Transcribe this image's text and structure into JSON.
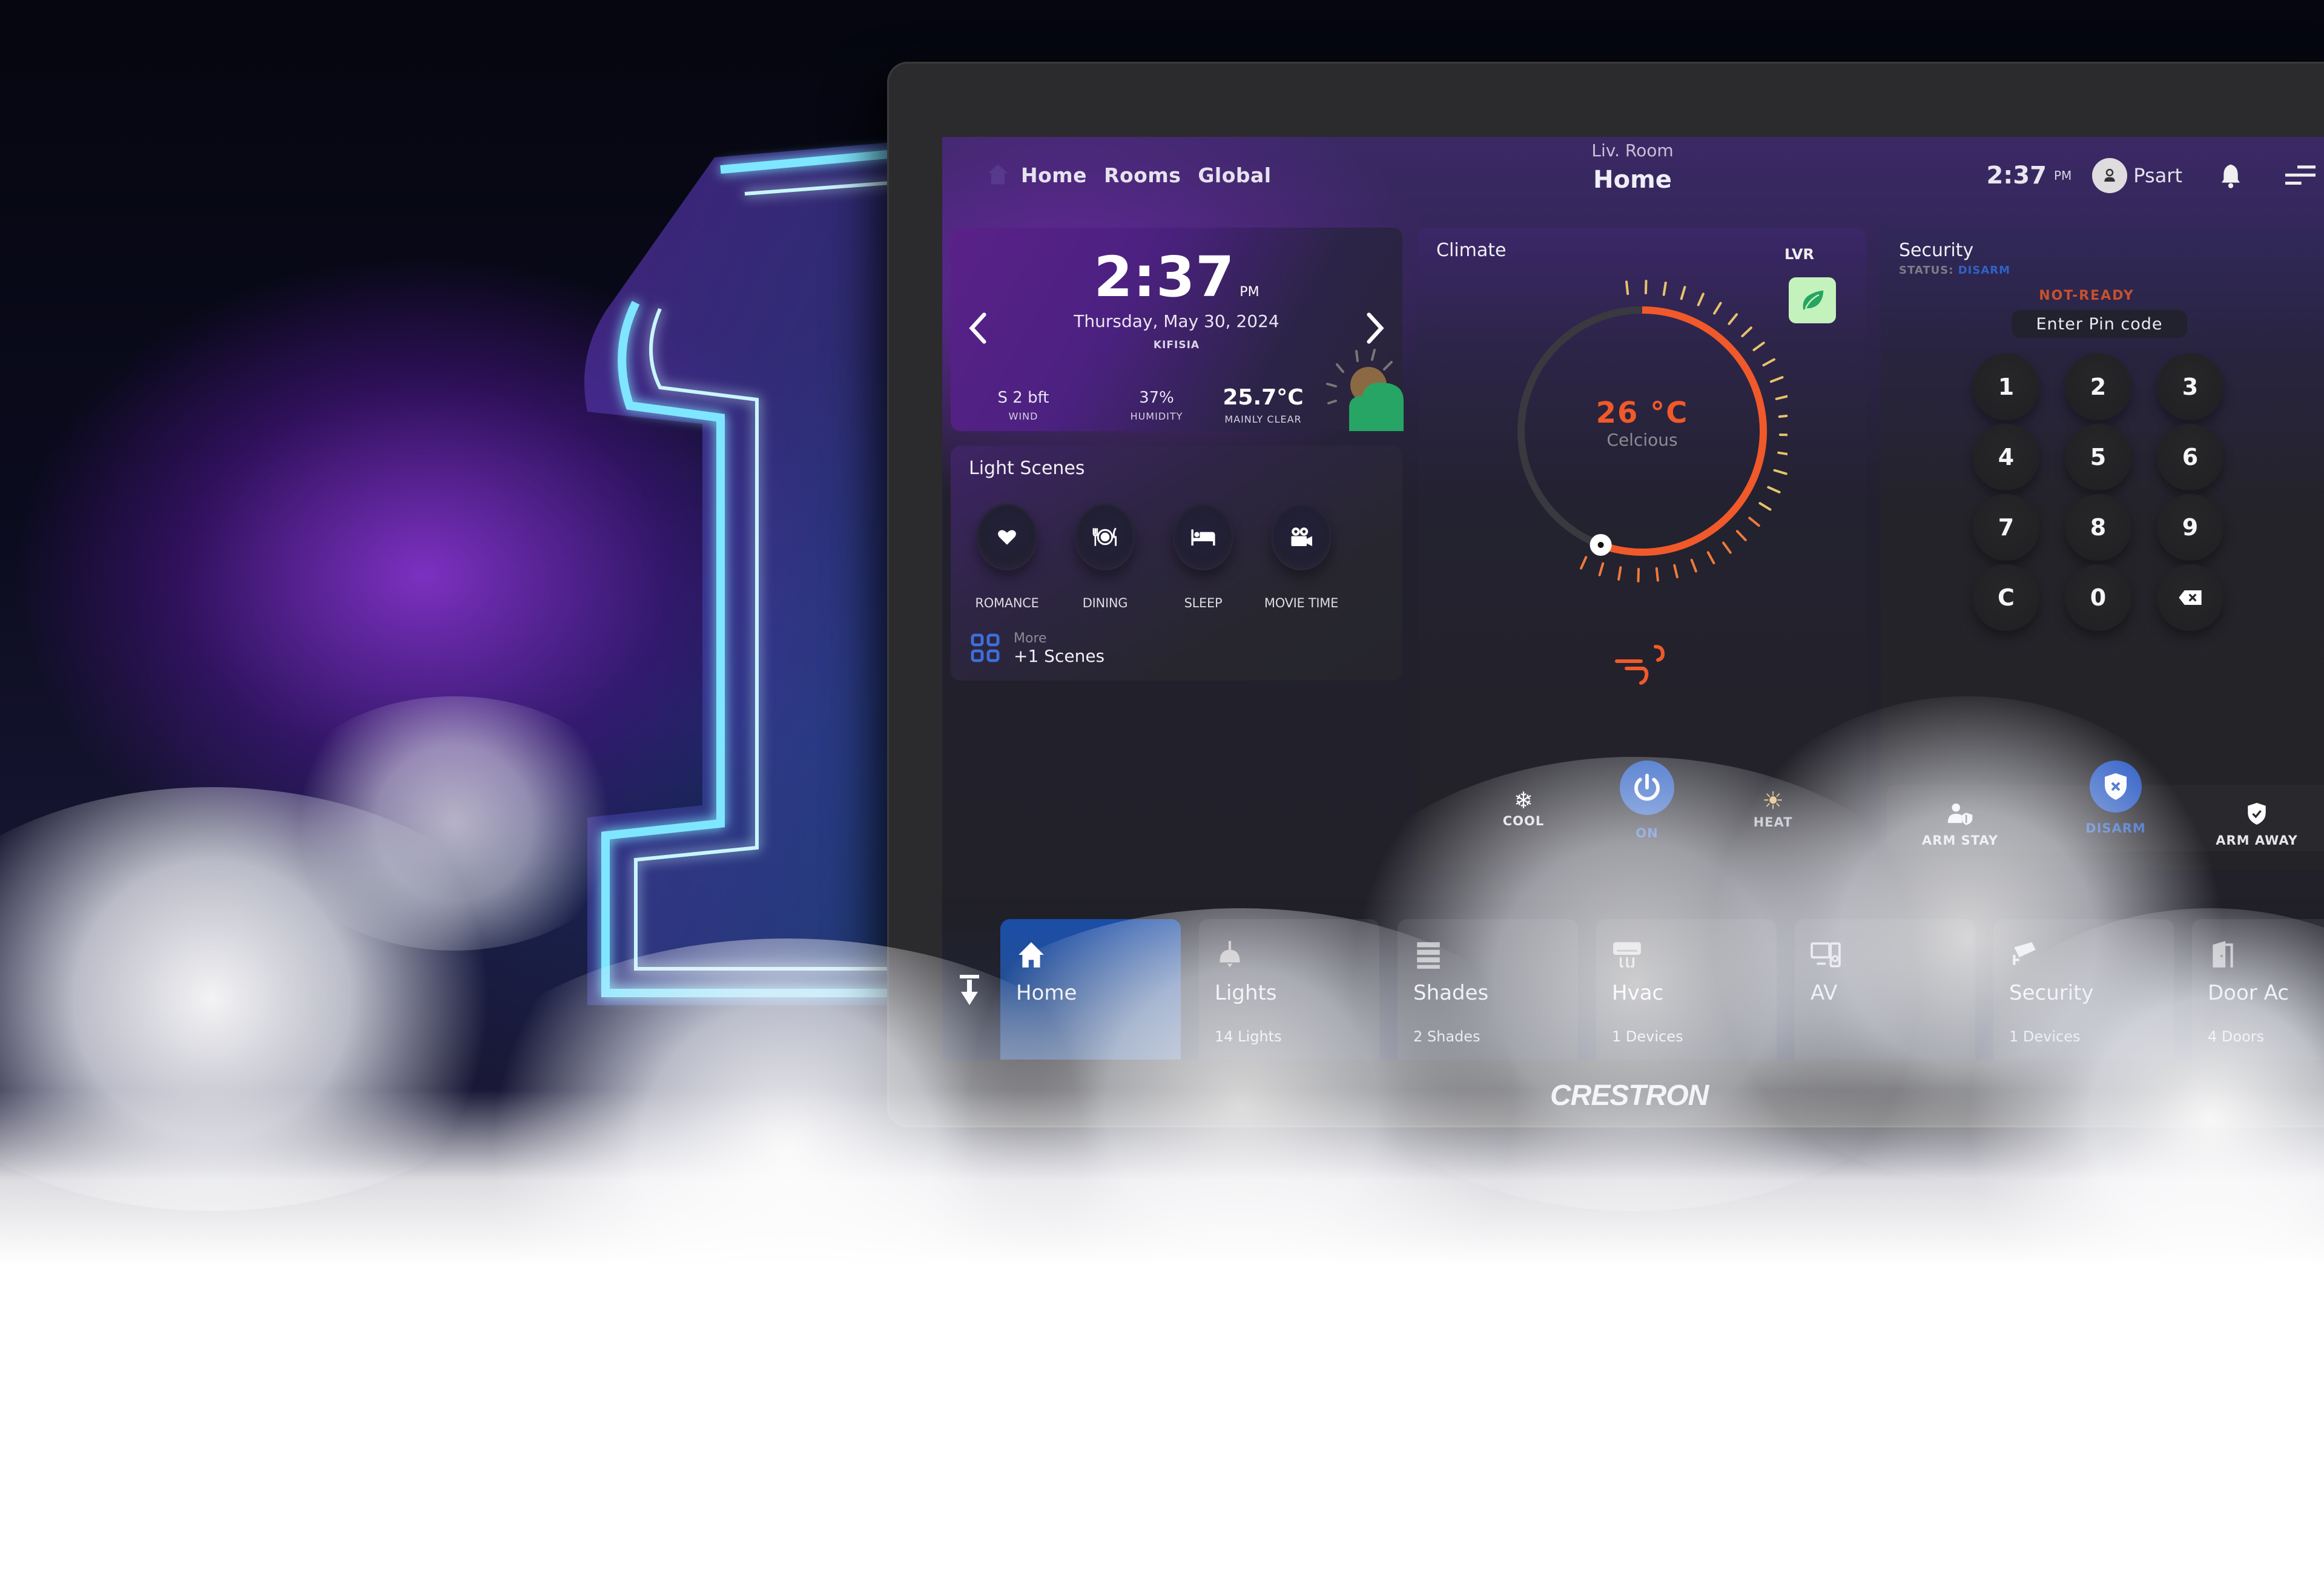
{
  "header": {
    "nav_links": [
      "Home",
      "Rooms",
      "Global"
    ],
    "room_subtitle": "Liv. Room",
    "room_title": "Home",
    "time": "2:37",
    "ampm": "PM",
    "user_name": "Psart"
  },
  "weather": {
    "time": "2:37",
    "ampm": "PM",
    "date": "Thursday, May 30, 2024",
    "city": "KIFISIA",
    "wind_value": "S 2 bft",
    "wind_label": "WIND",
    "humidity_value": "37%",
    "humidity_label": "HUMIDITY",
    "temp_value": "25.7°C",
    "condition_label": "MAINLY CLEAR",
    "icon": "partly-cloudy-icon"
  },
  "light_scenes": {
    "title": "Light Scenes",
    "scenes": [
      {
        "label": "ROMANCE",
        "icon": "heart-icon"
      },
      {
        "label": "DINING",
        "icon": "dining-icon"
      },
      {
        "label": "SLEEP",
        "icon": "bed-icon"
      },
      {
        "label": "MOVIE TIME",
        "icon": "movie-camera-icon"
      }
    ],
    "more_label": "More",
    "more_count": "+1 Scenes"
  },
  "climate": {
    "title": "Climate",
    "zone": "LVR",
    "setpoint": "26 °C",
    "unit_label": "Celcious",
    "setpoint_fraction": 0.5,
    "accent_color": "#f1592a",
    "eco_color": "#c4f2bd",
    "modes": {
      "cool": "COOL",
      "on": "ON",
      "heat": "HEAT"
    }
  },
  "security": {
    "title": "Security",
    "status_prefix": "STATUS:",
    "status_value": "DISARM",
    "readiness": "NOT-READY",
    "pin_placeholder": "Enter Pin code",
    "keys": [
      "1",
      "2",
      "3",
      "4",
      "5",
      "6",
      "7",
      "8",
      "9",
      "C",
      "0",
      "⌫"
    ],
    "arm_stay": "ARM STAY",
    "disarm": "DISARM",
    "arm_away": "ARM AWAY",
    "active_color": "#2f63c6",
    "warning_color": "#c8512c"
  },
  "bottom_nav": {
    "tiles": [
      {
        "name": "Home",
        "count": "",
        "icon": "home-icon",
        "active": true
      },
      {
        "name": "Lights",
        "count": "14 Lights",
        "icon": "ceiling-light-icon"
      },
      {
        "name": "Shades",
        "count": "2 Shades",
        "icon": "shades-icon"
      },
      {
        "name": "Hvac",
        "count": "1 Devices",
        "icon": "air-conditioner-icon"
      },
      {
        "name": "AV",
        "count": "",
        "icon": "av-devices-icon"
      },
      {
        "name": "Security",
        "count": "1 Devices",
        "icon": "security-camera-icon"
      },
      {
        "name": "Door Ac",
        "count": "4 Doors",
        "icon": "door-icon"
      }
    ]
  },
  "brand": "CRESTRON"
}
